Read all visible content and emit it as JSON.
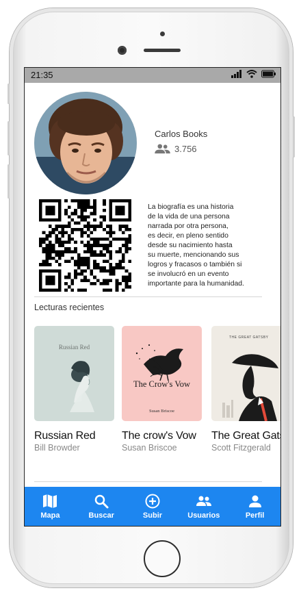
{
  "status_bar": {
    "time": "21:35"
  },
  "profile": {
    "name": "Carlos Books",
    "followers": "3.756",
    "bio": "La biografía es una historia\nde la vida de una persona\nnarrada por otra persona,\nes decir, en pleno sentido\ndesde su nacimiento hasta\nsu muerte, mencionando sus\nlogros y fracasos o también si\nse involucró en un evento\nimportante para la humanidad."
  },
  "recent": {
    "title": "Lecturas recientes",
    "books": [
      {
        "title": "Russian Red",
        "author": "Bill Browder",
        "cover_title": "Russian Red",
        "cover_bg": "#cfdbd7"
      },
      {
        "title": "The crow's Vow",
        "author": "Susan Briscoe",
        "cover_title": "The Crow's Vow",
        "cover_author": "Susan Briscoe",
        "cover_bg": "#f8c8c4"
      },
      {
        "title": "The Great Gatsby",
        "author": "Scott Fitzgerald",
        "cover_title": "THE GREAT GATSBY",
        "cover_bg": "#efebe4"
      }
    ]
  },
  "bottom_nav": [
    {
      "label": "Mapa",
      "icon": "map-icon"
    },
    {
      "label": "Buscar",
      "icon": "search-icon"
    },
    {
      "label": "Subir",
      "icon": "add-circle-icon"
    },
    {
      "label": "Usuarios",
      "icon": "users-icon"
    },
    {
      "label": "Perfil",
      "icon": "person-icon"
    }
  ],
  "colors": {
    "accent": "#1d86f0",
    "status_bar": "#a9a9a9"
  }
}
